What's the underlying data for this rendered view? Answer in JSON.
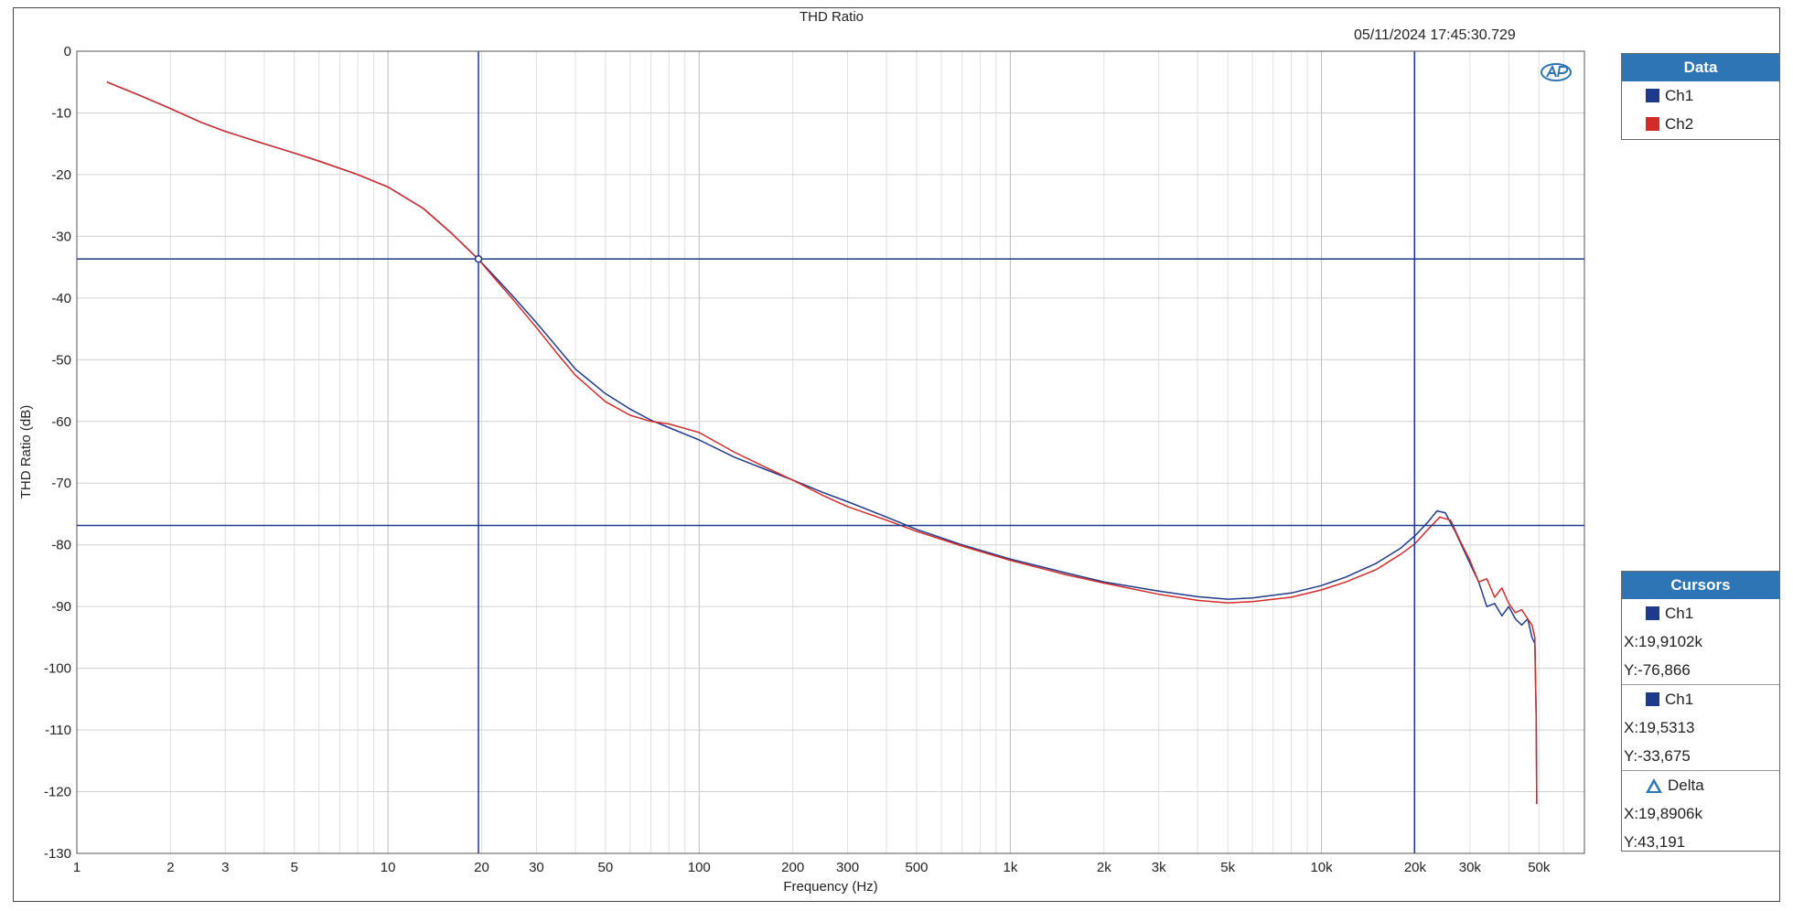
{
  "timestamp": "05/11/2024 17:45:30.729",
  "legend": {
    "title": "Data",
    "items": [
      {
        "label": "Ch1",
        "color": "#1f3a8a"
      },
      {
        "label": "Ch2",
        "color": "#d42a2a"
      }
    ]
  },
  "cursors": {
    "title": "Cursors",
    "c1": {
      "label": "Ch1",
      "x": "X:19,9102k",
      "y": "Y:-76,866"
    },
    "c2": {
      "label": "Ch1",
      "x": "X:19,5313",
      "y": "Y:-33,675"
    },
    "delta": {
      "label": "Delta",
      "x": "X:19,8906k",
      "y": "Y:43,191"
    }
  },
  "chart_data": {
    "type": "line",
    "title": "THD Ratio",
    "xlabel": "Frequency (Hz)",
    "ylabel": "THD Ratio (dB)",
    "xscale": "log",
    "xlim": [
      1,
      70000
    ],
    "ylim": [
      -130,
      0
    ],
    "grid": true,
    "legend_position": "right",
    "x_ticks": [
      {
        "v": 1,
        "l": "1"
      },
      {
        "v": 2,
        "l": "2"
      },
      {
        "v": 3,
        "l": "3"
      },
      {
        "v": 5,
        "l": "5"
      },
      {
        "v": 10,
        "l": "10"
      },
      {
        "v": 20,
        "l": "20"
      },
      {
        "v": 30,
        "l": "30"
      },
      {
        "v": 50,
        "l": "50"
      },
      {
        "v": 100,
        "l": "100"
      },
      {
        "v": 200,
        "l": "200"
      },
      {
        "v": 300,
        "l": "300"
      },
      {
        "v": 500,
        "l": "500"
      },
      {
        "v": 1000,
        "l": "1k"
      },
      {
        "v": 2000,
        "l": "2k"
      },
      {
        "v": 3000,
        "l": "3k"
      },
      {
        "v": 5000,
        "l": "5k"
      },
      {
        "v": 10000,
        "l": "10k"
      },
      {
        "v": 20000,
        "l": "20k"
      },
      {
        "v": 30000,
        "l": "30k"
      },
      {
        "v": 50000,
        "l": "50k"
      }
    ],
    "y_ticks": [
      0,
      -10,
      -20,
      -30,
      -40,
      -50,
      -60,
      -70,
      -80,
      -90,
      -100,
      -110,
      -120,
      -130
    ],
    "cursor_lines": {
      "x": [
        19.5313,
        19910.2
      ],
      "y": [
        -33.675,
        -76.866
      ]
    },
    "cursor_marker": {
      "x": 19.5313,
      "y": -33.675
    },
    "series": [
      {
        "name": "Ch1",
        "color": "#1f3a8a",
        "x": [
          1.25,
          1.6,
          2,
          2.5,
          3,
          4,
          5,
          6,
          8,
          10,
          13,
          16,
          19.5,
          22,
          25,
          30,
          35,
          40,
          50,
          60,
          70,
          80,
          100,
          130,
          160,
          200,
          250,
          300,
          400,
          500,
          700,
          1000,
          1500,
          2000,
          3000,
          4000,
          5000,
          6000,
          8000,
          10000,
          12000,
          15000,
          18000,
          20000,
          22000,
          23500,
          25000,
          27000,
          30000,
          32000,
          34000,
          36000,
          38000,
          40000,
          42000,
          44000,
          46000,
          47500,
          48500,
          49000,
          49200
        ],
        "y": [
          -5,
          -7.2,
          -9.3,
          -11.5,
          -13,
          -15,
          -16.5,
          -17.8,
          -20,
          -22,
          -25.5,
          -29.5,
          -33.7,
          -36.5,
          -39.5,
          -44,
          -48,
          -51.5,
          -55.5,
          -58,
          -59.8,
          -61,
          -63,
          -65.8,
          -67.6,
          -69.5,
          -71.5,
          -73,
          -75.5,
          -77.5,
          -80,
          -82.3,
          -84.5,
          -86,
          -87.5,
          -88.4,
          -88.8,
          -88.6,
          -87.8,
          -86.6,
          -85.2,
          -83,
          -80.5,
          -78.5,
          -76.3,
          -74.5,
          -74.8,
          -78,
          -83,
          -86,
          -90,
          -89.5,
          -91.5,
          -90,
          -92,
          -93,
          -92,
          -95,
          -96,
          -108,
          -122
        ]
      },
      {
        "name": "Ch2",
        "color": "#d42a2a",
        "x": [
          1.25,
          1.6,
          2,
          2.5,
          3,
          4,
          5,
          6,
          8,
          10,
          13,
          16,
          19.5,
          22,
          25,
          30,
          35,
          40,
          50,
          60,
          70,
          80,
          100,
          130,
          160,
          200,
          250,
          300,
          400,
          500,
          700,
          1000,
          1500,
          2000,
          3000,
          4000,
          5000,
          6000,
          8000,
          10000,
          12000,
          15000,
          18000,
          20000,
          22000,
          24000,
          26000,
          28000,
          30000,
          32000,
          34000,
          36000,
          38000,
          40000,
          42000,
          44000,
          46000,
          47500,
          48500,
          49000,
          49200
        ],
        "y": [
          -5,
          -7.2,
          -9.3,
          -11.5,
          -13,
          -15,
          -16.5,
          -17.8,
          -20,
          -22,
          -25.5,
          -29.5,
          -33.7,
          -36.8,
          -40,
          -44.8,
          -49,
          -52.5,
          -56.8,
          -59,
          -60,
          -60.4,
          -61.8,
          -65,
          -67.2,
          -69.5,
          -72,
          -73.8,
          -76,
          -77.8,
          -80.2,
          -82.5,
          -84.8,
          -86.2,
          -88,
          -89,
          -89.4,
          -89.2,
          -88.5,
          -87.3,
          -86,
          -84,
          -81.5,
          -79.8,
          -77.5,
          -75.5,
          -76,
          -79.5,
          -82.5,
          -86,
          -85.5,
          -88.5,
          -87,
          -89.5,
          -91,
          -90.5,
          -92,
          -93,
          -95,
          -108,
          -122
        ]
      }
    ]
  }
}
